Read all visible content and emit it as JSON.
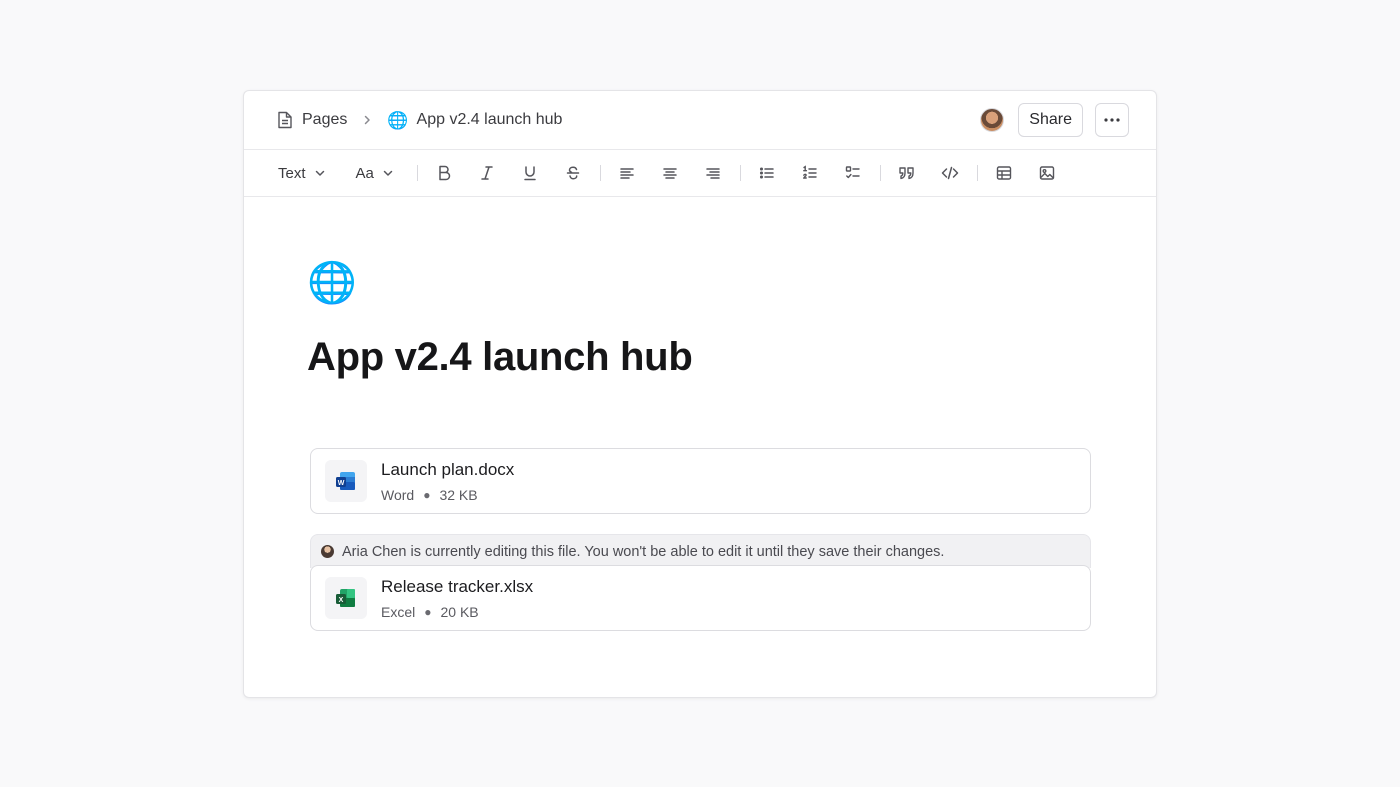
{
  "breadcrumb": {
    "root_label": "Pages",
    "page_label": "App v2.4 launch hub"
  },
  "header": {
    "share_label": "Share",
    "more_label": "···"
  },
  "toolbar": {
    "text_style_label": "Text",
    "font_size_label": "Aa"
  },
  "page": {
    "emoji": "🌐",
    "globe_small": "🌐",
    "title": "App v2.4 launch hub"
  },
  "files": [
    {
      "name": "Launch plan.docx",
      "type": "Word",
      "size": "32 KB"
    },
    {
      "name": "Release tracker.xlsx",
      "type": "Excel",
      "size": "20 KB"
    }
  ],
  "lock_notice": {
    "text": "Aria Chen is currently editing this file. You won't be able to edit it until they save their changes."
  },
  "colors": {
    "word_blue": "#185abd",
    "excel_green": "#107c41"
  }
}
